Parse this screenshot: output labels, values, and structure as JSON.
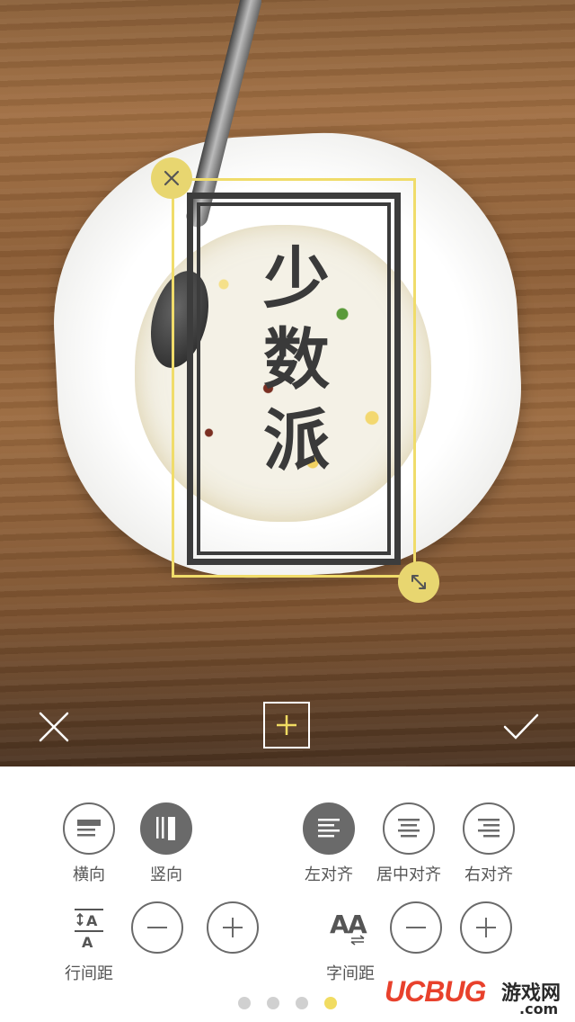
{
  "sticker": {
    "lines": [
      "少",
      "数",
      "派"
    ]
  },
  "toolbar": {
    "cancel_icon": "close-icon",
    "add_icon": "plus-icon",
    "confirm_icon": "check-icon"
  },
  "panel": {
    "direction": [
      {
        "label": "横向",
        "icon": "horizontal-text-icon",
        "selected": false
      },
      {
        "label": "竖向",
        "icon": "vertical-text-icon",
        "selected": true
      }
    ],
    "alignment": [
      {
        "label": "左对齐",
        "icon": "align-left-icon",
        "selected": true
      },
      {
        "label": "居中对齐",
        "icon": "align-center-icon",
        "selected": false
      },
      {
        "label": "右对齐",
        "icon": "align-right-icon",
        "selected": false
      }
    ],
    "line_spacing": {
      "label": "行间距",
      "icon": "line-spacing-icon"
    },
    "letter_spacing": {
      "label": "字间距",
      "icon": "letter-spacing-icon"
    }
  },
  "pagination": {
    "pages": 4,
    "current": 4
  },
  "watermark": {
    "brand": "UCBUG",
    "site": "游戏网",
    "domain": ".com"
  },
  "colors": {
    "accent": "#f1dc62",
    "control": "#6a6a6a"
  }
}
